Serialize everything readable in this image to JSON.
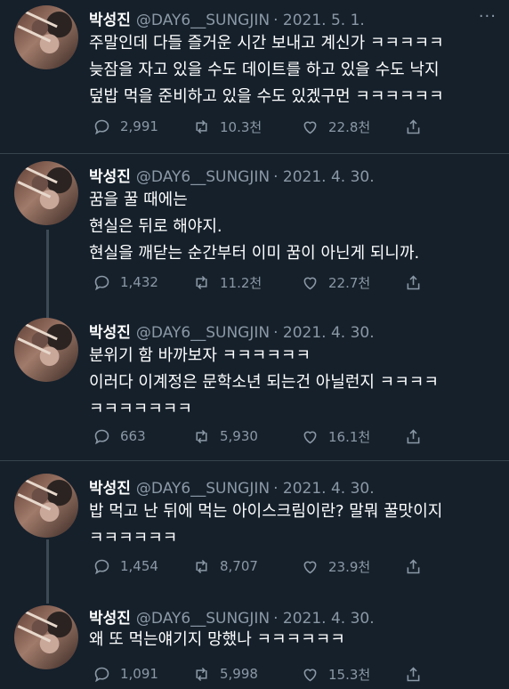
{
  "tweets": [
    {
      "name": "박성진",
      "handle": "@DAY6__SUNGJIN",
      "date": "· 2021. 5. 1.",
      "lines": [
        "주말인데 다들 즐거운 시간 보내고 계신가 ㅋㅋㅋㅋㅋ",
        "늦잠을 자고 있을 수도 데이트를 하고 있을 수도 낙지",
        "덮밥 먹을 준비하고 있을 수도 있겠구먼 ㅋㅋㅋㅋㅋㅋ"
      ],
      "replies": "2,991",
      "retweets": "10.3천",
      "likes": "22.8천",
      "more": "···"
    },
    {
      "name": "박성진",
      "handle": "@DAY6__SUNGJIN",
      "date": "· 2021. 4. 30.",
      "lines": [
        "꿈을 꿀 때에는",
        "현실은 뒤로 해야지.",
        "현실을 깨닫는 순간부터 이미 꿈이 아닌게 되니까."
      ],
      "replies": "1,432",
      "retweets": "11.2천",
      "likes": "22.7천"
    },
    {
      "name": "박성진",
      "handle": "@DAY6__SUNGJIN",
      "date": "· 2021. 4. 30.",
      "lines": [
        "분위기 함 바까보자 ㅋㅋㅋㅋㅋㅋ",
        "이러다 이계정은 문학소년 되는건 아닐런지 ㅋㅋㅋㅋ",
        "ㅋㅋㅋㅋㅋㅋㅋ"
      ],
      "replies": "663",
      "retweets": "5,930",
      "likes": "16.1천"
    },
    {
      "name": "박성진",
      "handle": "@DAY6__SUNGJIN",
      "date": "· 2021. 4. 30.",
      "lines": [
        "밥 먹고 난 뒤에 먹는 아이스크림이란? 말뭐 꿀맛이지",
        "ㅋㅋㅋㅋㅋㅋ"
      ],
      "replies": "1,454",
      "retweets": "8,707",
      "likes": "23.9천"
    },
    {
      "name": "박성진",
      "handle": "@DAY6__SUNGJIN",
      "date": "· 2021. 4. 30.",
      "lines": [
        "왜 또 먹는얘기지 망했나 ㅋㅋㅋㅋㅋㅋ"
      ],
      "replies": "1,091",
      "retweets": "5,998",
      "likes": "15.3천"
    }
  ]
}
